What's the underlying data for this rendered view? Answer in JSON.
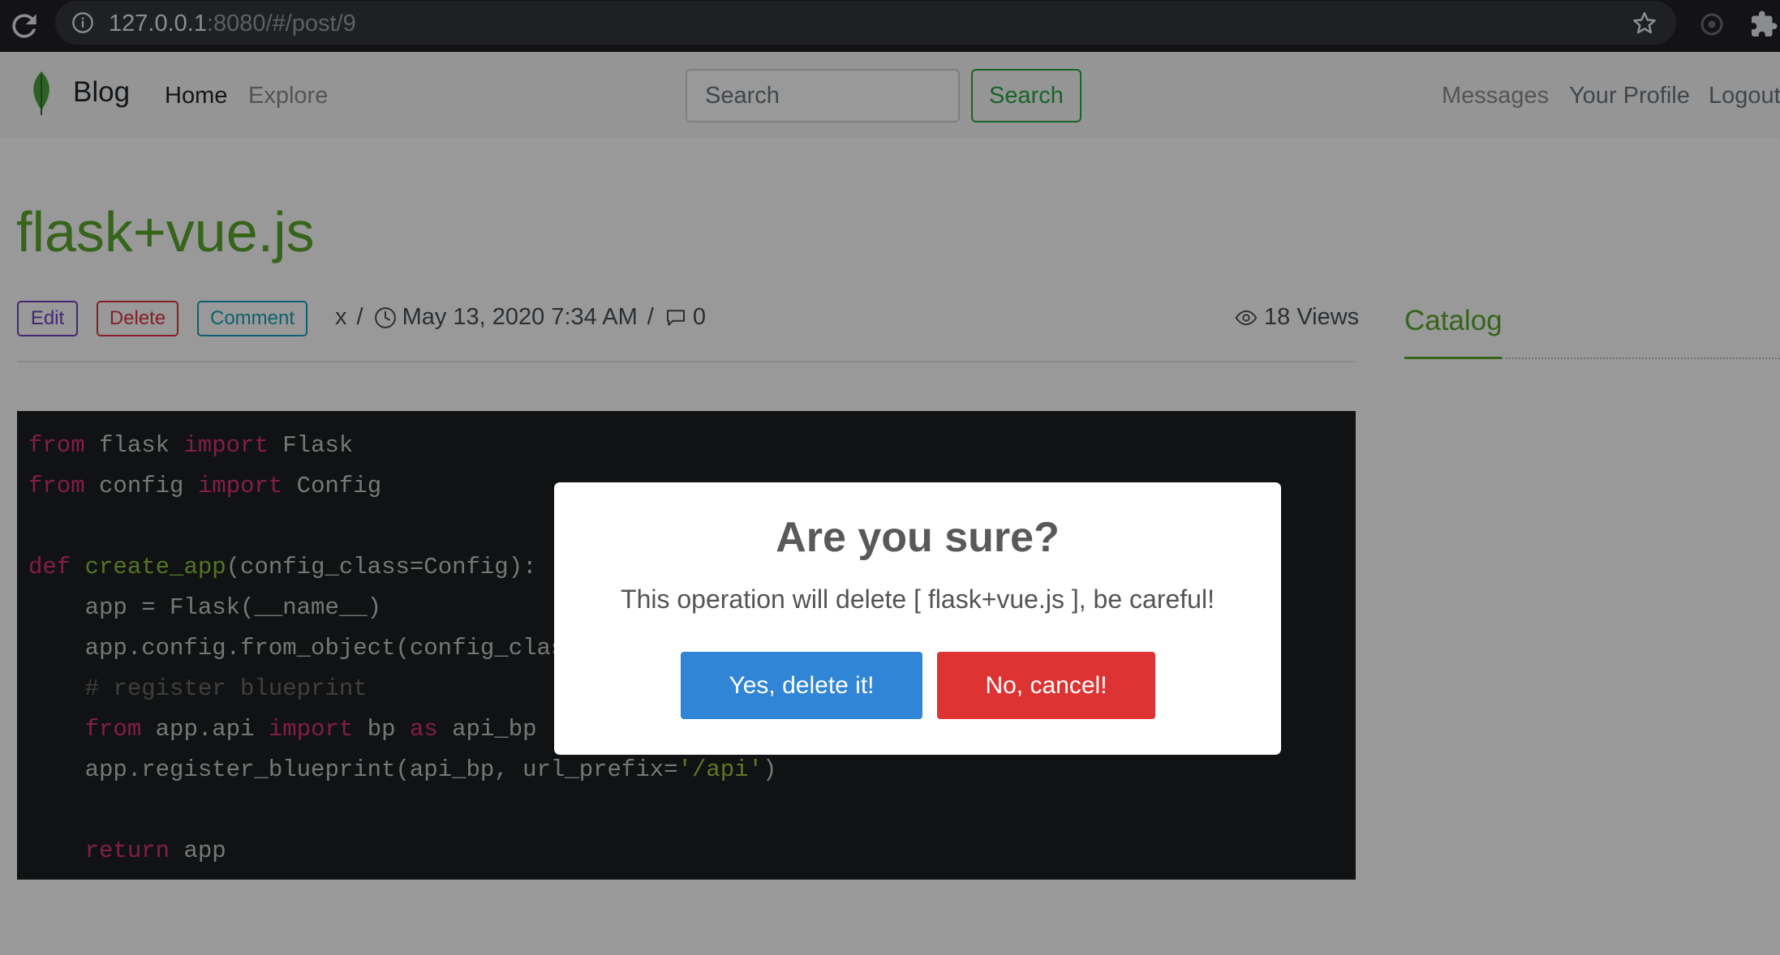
{
  "browser": {
    "url_host": "127.0.0.1",
    "url_rest": ":8080/#/post/9"
  },
  "navbar": {
    "brand": "Blog",
    "home": "Home",
    "explore": "Explore",
    "search_placeholder": "Search",
    "search_button": "Search",
    "messages": "Messages",
    "profile": "Your Profile",
    "logout": "Logout"
  },
  "post": {
    "title": "flask+vue.js",
    "edit_label": "Edit",
    "delete_label": "Delete",
    "comment_label": "Comment",
    "author": "x",
    "separator": "/",
    "date": "May 13, 2020 7:34 AM",
    "comments_count": "0",
    "views": "18 Views"
  },
  "sidebar": {
    "catalog": "Catalog"
  },
  "code": {
    "lines": [
      [
        [
          "kw",
          "from"
        ],
        [
          "pl",
          " flask "
        ],
        [
          "kw",
          "import"
        ],
        [
          "pl",
          " Flask"
        ]
      ],
      [
        [
          "kw",
          "from"
        ],
        [
          "pl",
          " config "
        ],
        [
          "kw",
          "import"
        ],
        [
          "pl",
          " Config"
        ]
      ],
      [],
      [
        [
          "kw",
          "def"
        ],
        [
          "pl",
          " "
        ],
        [
          "fn",
          "create_app"
        ],
        [
          "pl",
          "(config_class=Config):"
        ]
      ],
      [
        [
          "pl",
          "    app = Flask(__name__)"
        ]
      ],
      [
        [
          "pl",
          "    app.config.from_object(config_class)"
        ]
      ],
      [
        [
          "pl",
          "    "
        ],
        [
          "cm",
          "# register blueprint"
        ]
      ],
      [
        [
          "pl",
          "    "
        ],
        [
          "kw",
          "from"
        ],
        [
          "pl",
          " app.api "
        ],
        [
          "kw",
          "import"
        ],
        [
          "pl",
          " bp "
        ],
        [
          "kw",
          "as"
        ],
        [
          "pl",
          " api_bp"
        ]
      ],
      [
        [
          "pl",
          "    app.register_blueprint(api_bp, url_prefix="
        ],
        [
          "str",
          "'/api'"
        ],
        [
          "pl",
          ")"
        ]
      ],
      [],
      [
        [
          "pl",
          "    "
        ],
        [
          "kw",
          "return"
        ],
        [
          "pl",
          " app"
        ]
      ]
    ]
  },
  "modal": {
    "title": "Are you sure?",
    "text": "This operation will delete [ flask+vue.js ], be careful!",
    "confirm": "Yes, delete it!",
    "cancel": "No, cancel!"
  },
  "colors": {
    "accent_green": "#5aa72d",
    "confirm_blue": "#3085d6",
    "cancel_red": "#dd3333"
  },
  "icons": [
    "reload-icon",
    "info-icon",
    "star-icon",
    "sync-icon",
    "puzzle-icon",
    "leaf-icon",
    "clock-icon",
    "comment-icon",
    "eye-icon"
  ]
}
